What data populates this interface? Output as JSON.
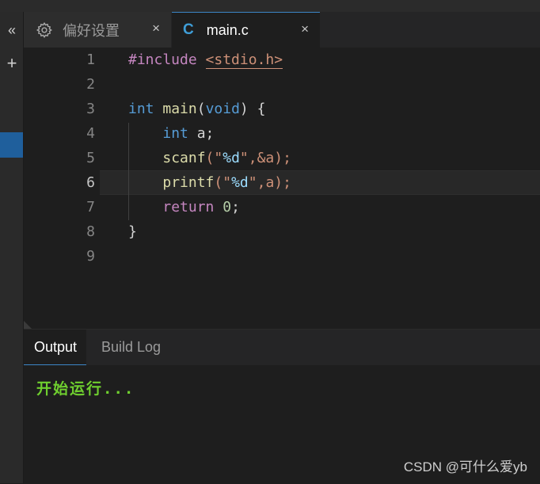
{
  "activity_bar": {
    "collapse_glyph": "«",
    "add_glyph": "+"
  },
  "tabs": [
    {
      "label": "偏好设置",
      "icon": "gear-icon",
      "close": "×"
    },
    {
      "label": "main.c",
      "icon": "c-file-icon",
      "icon_glyph": "C",
      "close": "×"
    }
  ],
  "editor": {
    "line_numbers": [
      "1",
      "2",
      "3",
      "4",
      "5",
      "6",
      "7",
      "8",
      "9"
    ],
    "active_line": 6
  },
  "code": {
    "l1_directive": "#include",
    "l1_header": "<stdio.h>",
    "l3_int": "int",
    "l3_main": "main",
    "l3_open": "(",
    "l3_void": "void",
    "l3_close": ") {",
    "l4_int": "int",
    "l4_rest": " a;",
    "l5_fn": "scanf",
    "l5_open": "(\"",
    "l5_fmt": "%d",
    "l5_rest": "\",&a);",
    "l6_fn": "printf",
    "l6_open": "(\"",
    "l6_fmt": "%d",
    "l6_rest": "\",a);",
    "l7_kw": "return",
    "l7_num": "0",
    "l7_rest": ";",
    "l8_brace": "}"
  },
  "panel": {
    "tabs": [
      "Output",
      "Build Log"
    ],
    "active_tab": "Output",
    "output_text": "开始运行..."
  },
  "watermark": "CSDN @可什么爱yb",
  "colors": {
    "accent": "#3c86c7",
    "keyword_purple": "#c586c0",
    "keyword_blue": "#569cd6",
    "function": "#dcdcaa",
    "string": "#ce9178",
    "output_green": "#6fcf2f"
  }
}
